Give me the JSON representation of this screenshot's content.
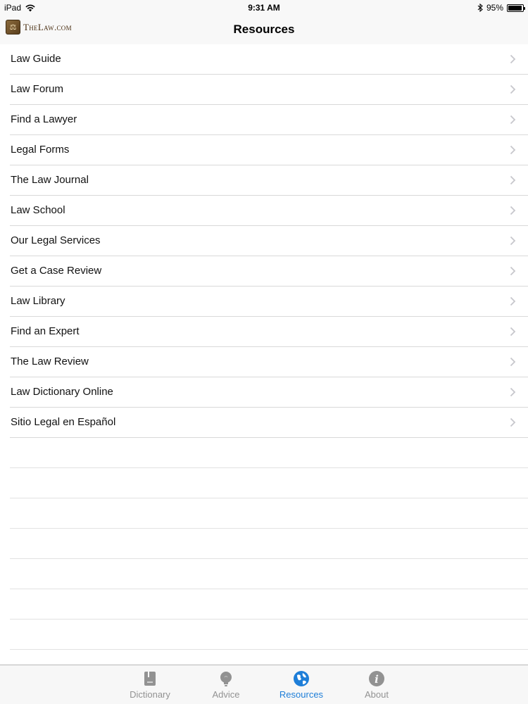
{
  "status_bar": {
    "device": "iPad",
    "time": "9:31 AM",
    "battery": "95%",
    "battery_level": 0.95
  },
  "nav": {
    "logo_text": "TheLaw.com",
    "title": "Resources"
  },
  "list": {
    "items": [
      {
        "label": "Law Guide"
      },
      {
        "label": "Law Forum"
      },
      {
        "label": "Find a Lawyer"
      },
      {
        "label": "Legal Forms"
      },
      {
        "label": "The Law Journal"
      },
      {
        "label": "Law School"
      },
      {
        "label": "Our Legal Services"
      },
      {
        "label": "Get a Case Review"
      },
      {
        "label": "Law Library"
      },
      {
        "label": "Find an Expert"
      },
      {
        "label": "The Law Review"
      },
      {
        "label": "Law Dictionary Online"
      },
      {
        "label": "Sitio Legal en Español"
      }
    ]
  },
  "tabs": [
    {
      "label": "Dictionary",
      "icon": "book-icon",
      "active": false
    },
    {
      "label": "Advice",
      "icon": "lightbulb-icon",
      "active": false
    },
    {
      "label": "Resources",
      "icon": "globe-icon",
      "active": true
    },
    {
      "label": "About",
      "icon": "info-icon",
      "active": false
    }
  ],
  "colors": {
    "accent": "#1e7ed8",
    "inactive": "#929292"
  }
}
